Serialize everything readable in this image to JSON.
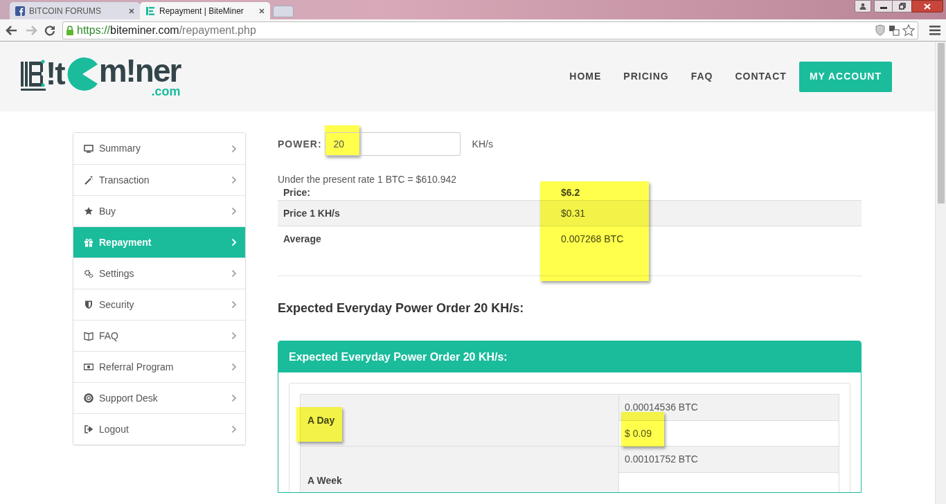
{
  "browser": {
    "tabs": [
      {
        "label": "BITCOIN FORUMS",
        "kind": "facebook",
        "selected": false
      },
      {
        "label": "Repayment | BiteMiner",
        "kind": "site",
        "selected": true
      }
    ],
    "url": {
      "scheme": "https://",
      "host": "biteminer.com",
      "path": "/repayment.php"
    }
  },
  "logo": {
    "parts": [
      "!t",
      "m!ner"
    ],
    "domain": ".com"
  },
  "nav": [
    {
      "label": "HOME",
      "kind": "link"
    },
    {
      "label": "PRICING",
      "kind": "link"
    },
    {
      "label": "FAQ",
      "kind": "link"
    },
    {
      "label": "CONTACT",
      "kind": "link"
    },
    {
      "label": "MY ACCOUNT",
      "kind": "button"
    }
  ],
  "sidebar": {
    "items": [
      {
        "label": "Summary",
        "selected": false
      },
      {
        "label": "Transaction",
        "selected": false
      },
      {
        "label": "Buy",
        "selected": false
      },
      {
        "label": "Repayment",
        "selected": true
      },
      {
        "label": "Settings",
        "selected": false
      },
      {
        "label": "Security",
        "selected": false
      },
      {
        "label": "FAQ",
        "selected": false
      },
      {
        "label": "Referral Program",
        "selected": false
      },
      {
        "label": "Support Desk",
        "selected": false
      },
      {
        "label": "Logout",
        "selected": false
      }
    ]
  },
  "power": {
    "label": "POWER:",
    "value": "20",
    "unit": "KH/s",
    "highlighted": true
  },
  "rate_note": "Under the present rate 1 BTC = $610.942",
  "rates": {
    "values_highlighted": true,
    "rows": [
      {
        "label": "Price:",
        "value": "$6.2",
        "bold": true
      },
      {
        "label": "Price 1 KH/s",
        "value": "$0.31",
        "bold": false
      },
      {
        "label": "Average",
        "value": "0.007268 BTC",
        "bold": false
      }
    ]
  },
  "expected_heading": "Expected Everyday Power Order 20 KH/s:",
  "panel": {
    "title": "Expected Everyday Power Order 20 KH/s:",
    "rows": [
      {
        "period": "A Day",
        "btc": "0.00014536 BTC",
        "usd": "$ 0.09",
        "highlighted": true,
        "usd_highlighted": true
      },
      {
        "period": "A Week",
        "btc": "0.00101752 BTC",
        "highlighted": false,
        "usd_highlighted": false
      }
    ]
  }
}
